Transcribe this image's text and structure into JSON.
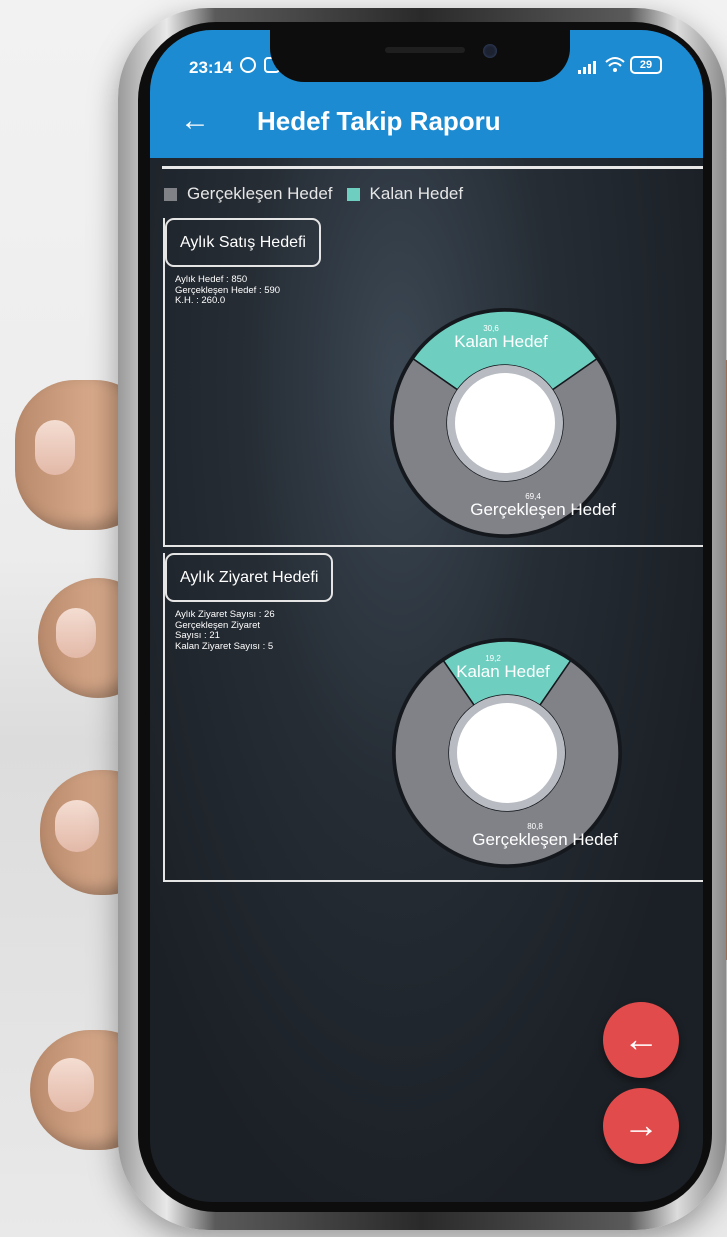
{
  "status": {
    "time": "23:14",
    "battery": "29"
  },
  "appbar": {
    "title": "Hedef Takip Raporu",
    "back_glyph": "←"
  },
  "legend": [
    {
      "label": "Gerçekleşen Hedef",
      "color": "#808288"
    },
    {
      "label": "Kalan Hedef",
      "color": "#6ecfc0"
    }
  ],
  "cards": [
    {
      "title": "Aylık Satış Hedefi",
      "info": [
        "Aylık Hedef : 850",
        "Gerçekleşen Hedef : 590",
        "K.H. : 260.0"
      ],
      "chart_data": {
        "type": "pie",
        "donut": true,
        "categories": [
          "Kalan Hedef",
          "Gerçekleşen Hedef"
        ],
        "values": [
          30.6,
          69.4
        ],
        "value_labels": [
          "30,6",
          "69,4"
        ],
        "colors": [
          "#6ecfc0",
          "#808288"
        ]
      }
    },
    {
      "title": "Aylık Ziyaret Hedefi",
      "info": [
        "Aylık Ziyaret Sayısı : 26",
        "Gerçekleşen Ziyaret",
        "Sayısı : 21",
        "Kalan Ziyaret Sayısı : 5"
      ],
      "chart_data": {
        "type": "pie",
        "donut": true,
        "categories": [
          "Kalan Hedef",
          "Gerçekleşen Hedef"
        ],
        "values": [
          19.2,
          80.8
        ],
        "value_labels": [
          "19,2",
          "80,8"
        ],
        "colors": [
          "#6ecfc0",
          "#808288"
        ]
      }
    }
  ],
  "fab": {
    "prev_glyph": "←",
    "next_glyph": "→",
    "color": "#e24b4b"
  }
}
